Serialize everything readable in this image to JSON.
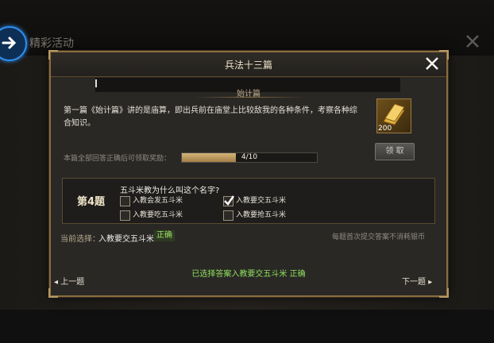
{
  "background": {
    "title": "精彩活动",
    "back_icon": "arrow-right-circle-icon",
    "close_icon": "close-icon"
  },
  "dialog": {
    "title": "兵法十三篇",
    "chapter_label": "始计篇",
    "chapter_prefix_mark": "!",
    "description": "第一篇《始计篇》讲的是庙算，即出兵前在庙堂上比较敌我的各种条件，考察各种综合知识。",
    "reward": {
      "count": "200",
      "icon": "gold-bar-icon",
      "claim_label": "领 取"
    },
    "progress": {
      "label": "本篇全部回答正确后可领取奖励：",
      "text": "4/10",
      "fraction": 0.4
    },
    "question": {
      "number_label": "第4题",
      "text": "五斗米教为什么叫这个名字?",
      "options": [
        {
          "label": "入教会发五斗米",
          "checked": false
        },
        {
          "label": "入教要交五斗米",
          "checked": true
        },
        {
          "label": "入教要吃五斗米",
          "checked": false
        },
        {
          "label": "入教要抢五斗米",
          "checked": false
        }
      ]
    },
    "current_selection_label": "当前选择：",
    "current_selection_value": "入教要交五斗米",
    "correct_tag": "正确",
    "note": "每题首次提交答案不消耗银币",
    "result_text": "已选择答案入教要交五斗米 正确",
    "prev_label": "上一题",
    "next_label": "下一题"
  },
  "colors": {
    "accent_gold": "#8a6d3f",
    "correct_green": "#8fe05f",
    "back_blue": "#2e8ff0"
  }
}
